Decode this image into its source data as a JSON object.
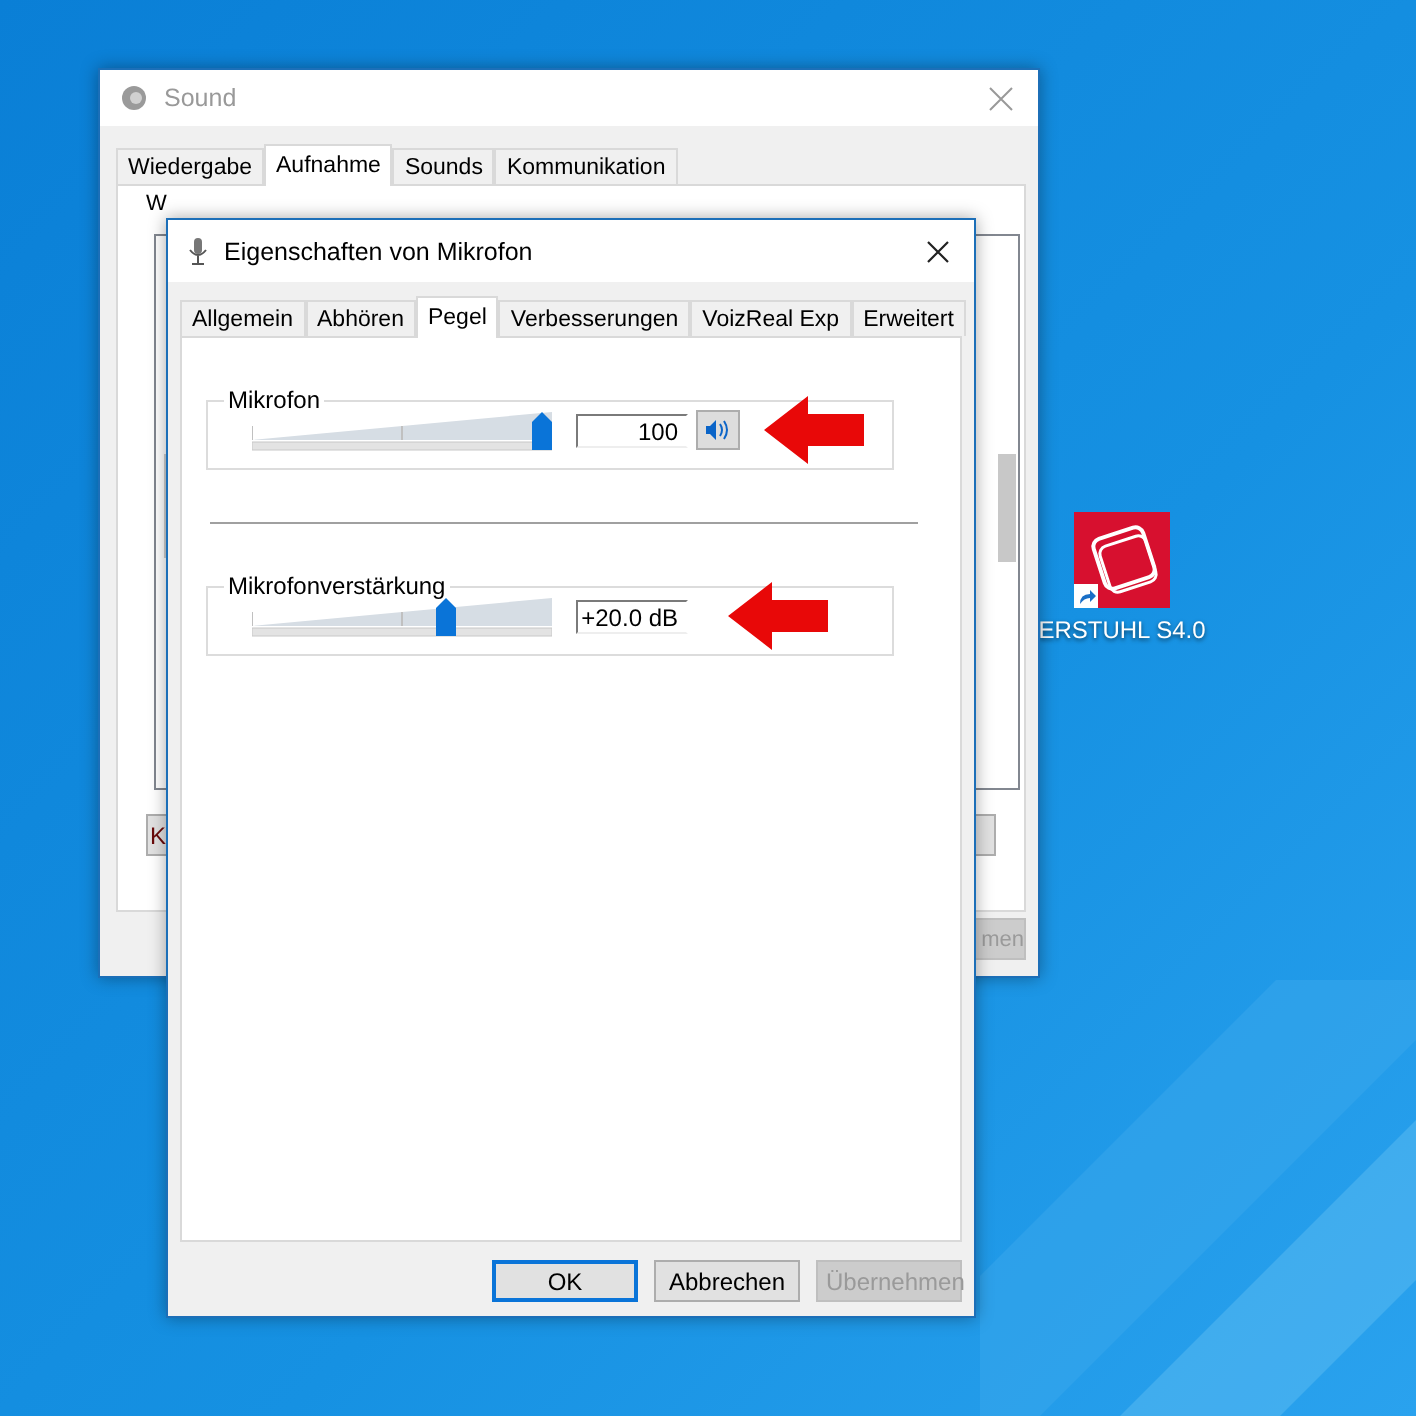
{
  "sound_window": {
    "title": "Sound",
    "tabs": [
      {
        "label": "Wiedergabe",
        "selected": false
      },
      {
        "label": "Aufnahme",
        "selected": true
      },
      {
        "label": "Sounds",
        "selected": false
      },
      {
        "label": "Kommunikation",
        "selected": false
      }
    ],
    "instruction": "W",
    "list_button": "K",
    "apply_button": "men"
  },
  "dialog": {
    "title": "Eigenschaften von Mikrofon",
    "tabs": [
      {
        "label": "Allgemein",
        "selected": false
      },
      {
        "label": "Abhören",
        "selected": false
      },
      {
        "label": "Pegel",
        "selected": true
      },
      {
        "label": "Verbesserungen",
        "selected": false
      },
      {
        "label": "VoizReal Exp",
        "selected": false
      },
      {
        "label": "Erweitert",
        "selected": false
      }
    ],
    "groups": [
      {
        "kind": "volume",
        "label": "Mikrofon",
        "level": 1.0,
        "value": "100"
      },
      {
        "kind": "boost",
        "label": "Mikrofonverstärkung",
        "level": 0.66,
        "value": "+20.0 dB"
      }
    ],
    "buttons": [
      {
        "label": "OK",
        "default": true,
        "disabled": false
      },
      {
        "label": "Abbrechen",
        "default": false,
        "disabled": false
      },
      {
        "label": "Übernehmen",
        "default": false,
        "disabled": true
      }
    ]
  },
  "desktop_icon": {
    "label": "ERSTUHL S4.0"
  }
}
